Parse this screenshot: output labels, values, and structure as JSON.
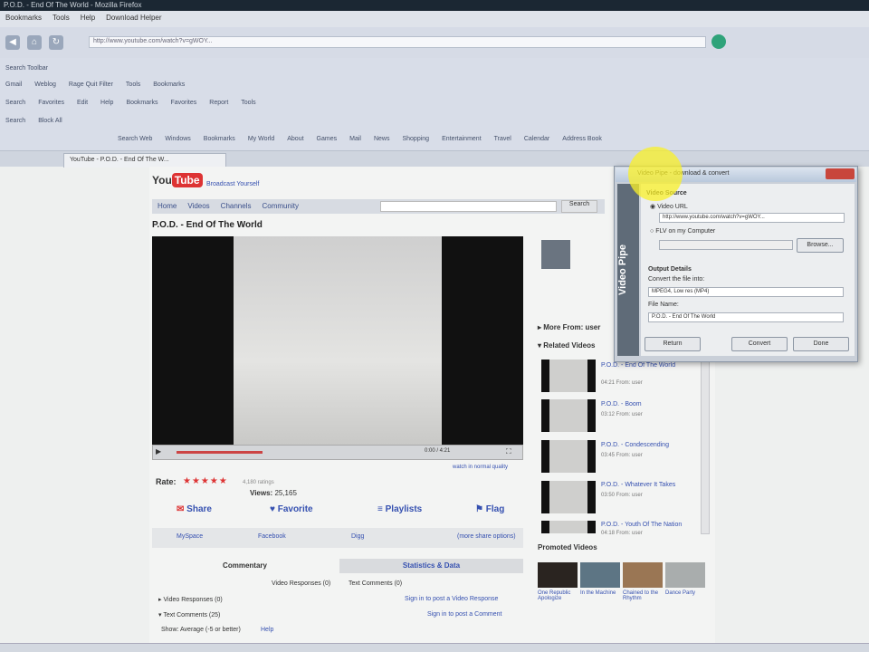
{
  "window": {
    "title": "P.O.D. - End Of The World - Mozilla Firefox"
  },
  "menu": [
    "Bookmarks",
    "Tools",
    "Help",
    "Download Helper"
  ],
  "address": {
    "url": "http://www.youtube.com/watch?v=gWOY..."
  },
  "toolbars": {
    "row1": [
      "Search Toolbar"
    ],
    "row2": [
      "Gmail",
      "Weblog",
      "Rage Quit Filter",
      "Tools",
      "Bookmarks"
    ],
    "row3": [
      "Search",
      "Favorites",
      "Edit",
      "Help",
      "Bookmarks",
      "Favorites",
      "Report",
      "Tools"
    ],
    "row4": [
      "Search",
      "Block All"
    ],
    "row5": [
      "Search Web",
      "Windows",
      "Bookmarks",
      "My World",
      "About",
      "Games",
      "Mail",
      "News",
      "Shopping",
      "Entertainment",
      "Travel",
      "Calendar",
      "Address Book"
    ]
  },
  "tab": {
    "label": "YouTube - P.O.D. - End Of The W..."
  },
  "youtube": {
    "logo_a": "You",
    "logo_b": "Tube",
    "tagline": "Broadcast Yourself",
    "nav": [
      "Home",
      "Videos",
      "Channels",
      "Community"
    ],
    "search_button": "Search",
    "video_title": "P.O.D. - End Of The World",
    "time": "0:00 / 4:21",
    "watch_hq": "watch in normal quality",
    "rate_label": "Rate:",
    "stars": "★★★★★",
    "ratings": "4,180 ratings",
    "views_label": "Views:",
    "views": "25,165",
    "actions": [
      "Share",
      "Favorite",
      "Playlists",
      "Flag"
    ],
    "sub_actions": [
      "MySpace",
      "Facebook",
      "Digg",
      "(more share options)"
    ],
    "comment_tabs": [
      "Commentary",
      "Statistics & Data"
    ],
    "comment_filters": [
      "Video Responses (0)",
      "Text Comments (0)"
    ],
    "video_responses": "Video Responses (0)",
    "video_responses_link": "Sign in to post a Video Response",
    "text_comments": "Text Comments (25)",
    "text_comments_link": "Sign in to post a Comment",
    "show": "Show: Average (-5 or better)",
    "help": "Help"
  },
  "sidebar": {
    "more_from": "More From: user",
    "related": "Related Videos",
    "promoted": "Promoted Videos",
    "related_videos": [
      {
        "title": "P.O.D. - End Of The World",
        "meta": "04:21 From: user"
      },
      {
        "title": "P.O.D. - Boom",
        "meta": "03:12 From: user"
      },
      {
        "title": "P.O.D. - Condescending",
        "meta": "03:45 From: user"
      },
      {
        "title": "P.O.D. - Whatever It Takes",
        "meta": "03:50 From: user"
      },
      {
        "title": "P.O.D. - Youth Of The Nation",
        "meta": "04:18 From: user"
      }
    ],
    "promoted_videos": [
      "One Republic Apologize",
      "In the Machine",
      "Chained to the Rhythm",
      "Dance Party"
    ]
  },
  "dialog": {
    "title": "Video Pipe - download & convert",
    "side_label": "Video Pipe",
    "section_source": "Video Source",
    "opt_url": "Video URL",
    "url_value": "http://www.youtube.com/watch?v=gWOY...",
    "opt_file": "FLV on my Computer",
    "browse": "Browse...",
    "section_output": "Output Details",
    "convert_label": "Convert the file into:",
    "format": "MPEG4, Low res (MP4)",
    "file_name_label": "File Name:",
    "file_name": "P.O.D. - End Of The World",
    "buttons": [
      "Return",
      "Convert",
      "Done"
    ]
  }
}
